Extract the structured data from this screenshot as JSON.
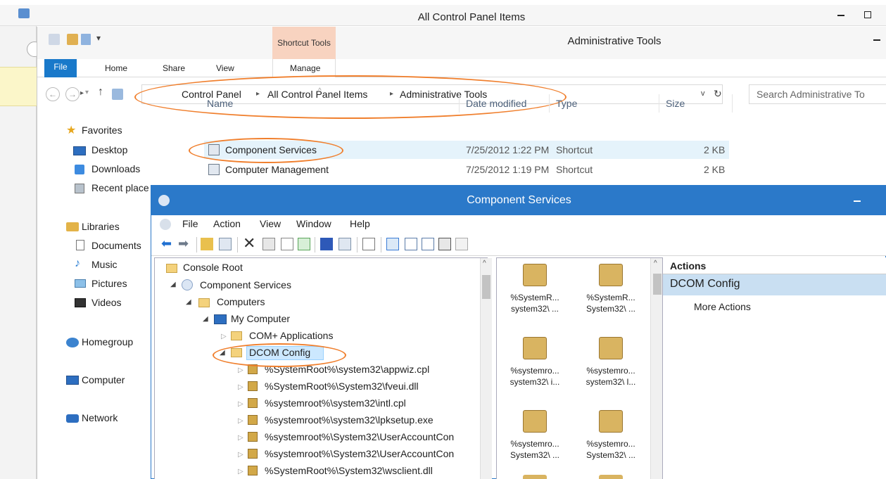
{
  "outer_window": {
    "title": "All Control Panel Items"
  },
  "explorer": {
    "title": "Administrative Tools",
    "context_tab_group": "Shortcut Tools",
    "ribbon_tabs": [
      "File",
      "Home",
      "Share",
      "View",
      "Manage"
    ],
    "address": {
      "crumbs": [
        "Control Panel",
        "All Control Panel Items",
        "Administrative Tools"
      ]
    },
    "search": {
      "placeholder": "Search Administrative To"
    },
    "nav": {
      "favorites_header": "Favorites",
      "favorites": [
        "Desktop",
        "Downloads",
        "Recent place"
      ],
      "libraries_header": "Libraries",
      "libraries": [
        "Documents",
        "Music",
        "Pictures",
        "Videos"
      ],
      "homegroup": "Homegroup",
      "computer": "Computer",
      "network": "Network"
    },
    "columns": {
      "name": "Name",
      "date": "Date modified",
      "type": "Type",
      "size": "Size"
    },
    "files": [
      {
        "name": "Component Services",
        "date": "7/25/2012 1:22 PM",
        "type": "Shortcut",
        "size": "2 KB"
      },
      {
        "name": "Computer Management",
        "date": "7/25/2012 1:19 PM",
        "type": "Shortcut",
        "size": "2 KB"
      }
    ]
  },
  "component_services": {
    "title": "Component Services",
    "menu": [
      "File",
      "Action",
      "View",
      "Window",
      "Help"
    ],
    "tree": {
      "console_root": "Console Root",
      "component_services": "Component Services",
      "computers": "Computers",
      "my_computer": "My Computer",
      "com_plus": "COM+ Applications",
      "dcom_config": "DCOM Config",
      "entries": [
        "%SystemRoot%\\system32\\appwiz.cpl",
        "%SystemRoot%\\System32\\fveui.dll",
        "%systemroot%\\system32\\intl.cpl",
        "%systemroot%\\system32\\lpksetup.exe",
        "%systemroot%\\System32\\UserAccountCon",
        "%systemroot%\\System32\\UserAccountCon",
        "%SystemRoot%\\System32\\wsclient.dll"
      ]
    },
    "icon_items": [
      {
        "line1": "%SystemR...",
        "line2": "system32\\ ..."
      },
      {
        "line1": "%SystemR...",
        "line2": "System32\\ ..."
      },
      {
        "line1": "%systemro...",
        "line2": "system32\\ i..."
      },
      {
        "line1": "%systemro...",
        "line2": "system32\\ l..."
      },
      {
        "line1": "%systemro...",
        "line2": "System32\\ ..."
      },
      {
        "line1": "%systemro...",
        "line2": "System32\\ ..."
      }
    ],
    "actions": {
      "header": "Actions",
      "selected": "DCOM Config",
      "more": "More Actions"
    }
  },
  "colors": {
    "accent_blue": "#2b79c9",
    "file_tab_blue": "#1979ca",
    "shortcut_tools_tint": "#f8d3c0",
    "annotation_orange": "#f07f2d"
  }
}
